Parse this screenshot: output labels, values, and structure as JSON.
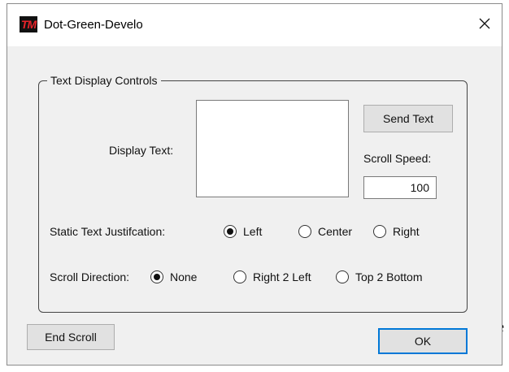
{
  "background_fragment": "e",
  "window": {
    "title": "Dot-Green-Develo",
    "icon_text": "TM",
    "close_icon": "close-icon"
  },
  "group": {
    "legend": "Text Display Controls",
    "display_text_label": "Display Text:",
    "display_text_value": "",
    "send_text_label": "Send Text",
    "scroll_speed_label": "Scroll Speed:",
    "scroll_speed_value": "100",
    "justification": {
      "label": "Static Text Justifcation:",
      "options": [
        {
          "label": "Left",
          "selected": true
        },
        {
          "label": "Center",
          "selected": false
        },
        {
          "label": "Right",
          "selected": false
        }
      ]
    },
    "scroll_direction": {
      "label": "Scroll Direction:",
      "options": [
        {
          "label": "None",
          "selected": true
        },
        {
          "label": "Right 2 Left",
          "selected": false
        },
        {
          "label": "Top 2 Bottom",
          "selected": false
        }
      ]
    }
  },
  "buttons": {
    "end_scroll": "End Scroll",
    "ok": "OK"
  },
  "colors": {
    "dialog_bg": "#f0f0f0",
    "default_button_border": "#0078d7",
    "icon_red": "#e8232a"
  }
}
